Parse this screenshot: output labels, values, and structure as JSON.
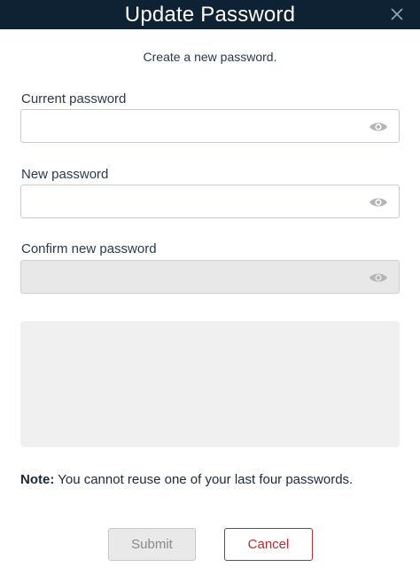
{
  "dialog": {
    "title": "Update Password",
    "subtitle": "Create a new password."
  },
  "fields": {
    "current_password": {
      "label": "Current password",
      "value": ""
    },
    "new_password": {
      "label": "New password",
      "value": ""
    },
    "confirm_password": {
      "label": "Confirm new password",
      "value": "",
      "disabled": true
    }
  },
  "note": {
    "prefix": "Note:",
    "text": " You cannot reuse one of your last four passwords."
  },
  "buttons": {
    "submit": "Submit",
    "cancel": "Cancel"
  },
  "colors": {
    "titlebar": "#0f2233",
    "cancel_accent": "#c0282d"
  },
  "icons": {
    "close": "close-icon",
    "toggle_visibility": "eye-icon"
  }
}
